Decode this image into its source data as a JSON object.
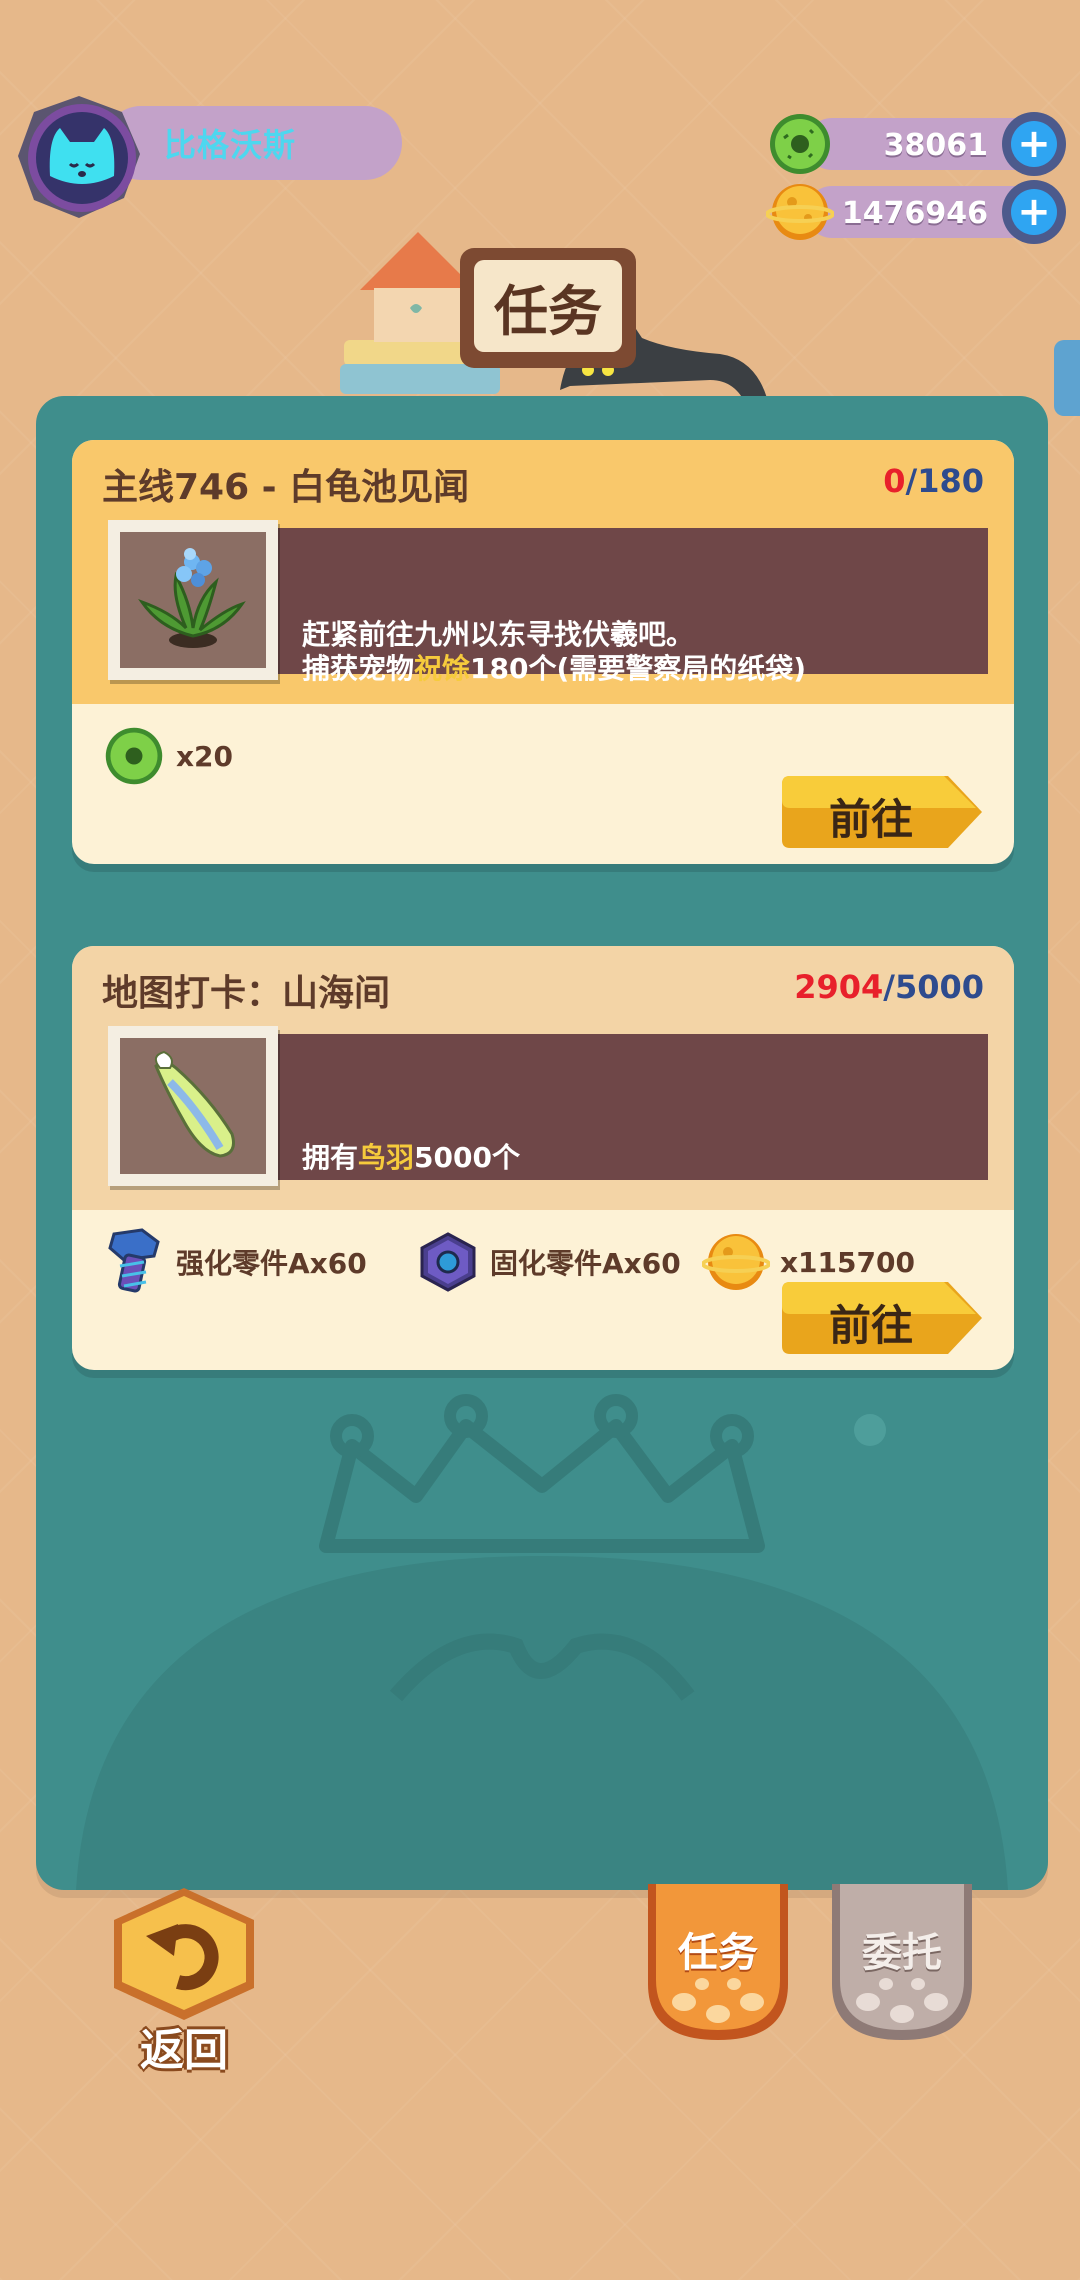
{
  "player": {
    "name": "比格沃斯"
  },
  "currencies": [
    {
      "icon": "green-donut-icon",
      "value": "38061"
    },
    {
      "icon": "gold-planet-coin-icon",
      "value": "1476946"
    }
  ],
  "page_title": "任务",
  "tasks": [
    {
      "title": "主线746 - 白龟池见闻",
      "progress_current": "0",
      "progress_sep": "/",
      "progress_max": "180",
      "image": "flower-plant-icon",
      "desc_line1": "赶紧前往九州以东寻找伏羲吧。",
      "desc_line2_pre": "捕获宠物",
      "desc_line2_highlight": "祝馀",
      "desc_line2_post": "180个(需要警察局的纸袋)",
      "rewards": [
        {
          "icon": "green-donut-icon",
          "text": "x20"
        }
      ],
      "button": "前往"
    },
    {
      "title": "地图打卡：山海间",
      "progress_current": "2904",
      "progress_sep": "/",
      "progress_max": "5000",
      "image": "feather-icon",
      "desc_pre": "拥有",
      "desc_highlight": "鸟羽",
      "desc_post": "5000个",
      "rewards": [
        {
          "icon": "bolt-part-icon",
          "text": "强化零件Ax60"
        },
        {
          "icon": "hex-nut-icon",
          "text": "固化零件Ax60"
        },
        {
          "icon": "gold-planet-coin-icon",
          "text": "x115700"
        }
      ],
      "button": "前往"
    }
  ],
  "bottom": {
    "back_label": "返回",
    "tabs": [
      {
        "label": "任务",
        "active": true
      },
      {
        "label": "委托",
        "active": false
      }
    ]
  },
  "colors": {
    "background": "#E6B88A",
    "panel": "#3F8E8C",
    "card": "#FDF2D6",
    "card_header": "#F9C86B",
    "desc_box": "#6F4748",
    "highlight": "#F6CB3C",
    "progress_current": "#E8202B",
    "progress_max": "#2E4B8E"
  }
}
